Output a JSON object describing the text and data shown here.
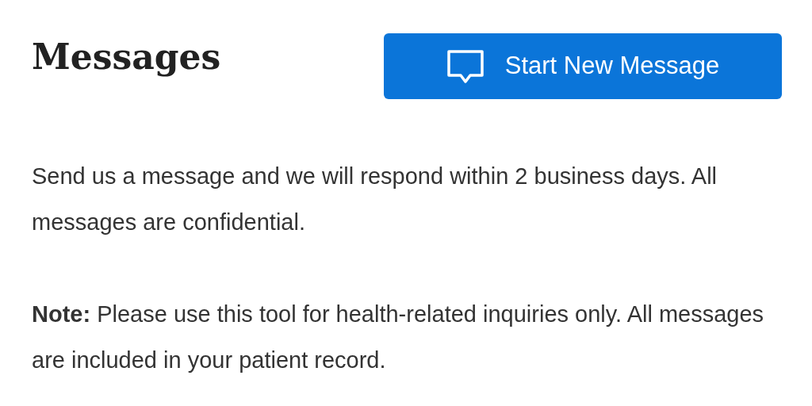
{
  "title": "Messages",
  "new_message_button": {
    "label": "Start New Message"
  },
  "paragraphs": [
    "Send us a message and we will respond within 2 business days. All messages are confidential.",
    "**Note:** Please use this tool for health-related inquiries only. All messages are included in your patient record."
  ]
}
